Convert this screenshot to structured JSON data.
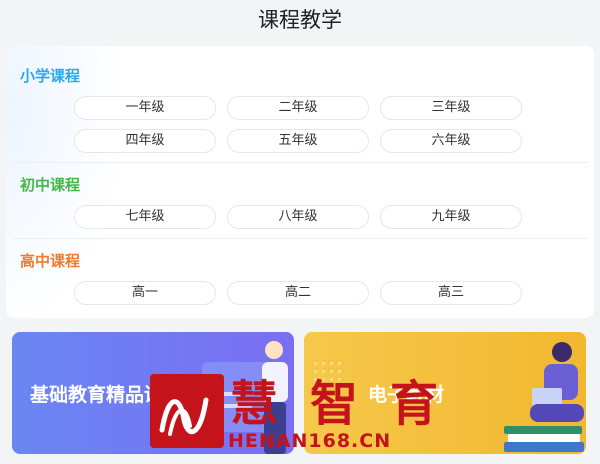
{
  "header": {
    "title": "课程教学"
  },
  "sections": {
    "primary": {
      "title": "小学课程",
      "grades": [
        "一年级",
        "二年级",
        "三年级",
        "四年级",
        "五年级",
        "六年级"
      ]
    },
    "middle": {
      "title": "初中课程",
      "grades": [
        "七年级",
        "八年级",
        "九年级"
      ]
    },
    "high": {
      "title": "高中课程",
      "grades": [
        "高一",
        "高二",
        "高三"
      ]
    }
  },
  "banners": {
    "left": {
      "label": "基础教育精品课",
      "color": "#6a86f3"
    },
    "right": {
      "label": "电子教材",
      "color": "#f6c84a"
    }
  },
  "watermark": {
    "word1": "慧",
    "word2": "智",
    "word3": "育",
    "url": "HENAN168.CN"
  },
  "colors": {
    "primary": "#2aa7ee",
    "middle": "#45b649",
    "high": "#f07a2e",
    "watermark": "#c5131b"
  }
}
